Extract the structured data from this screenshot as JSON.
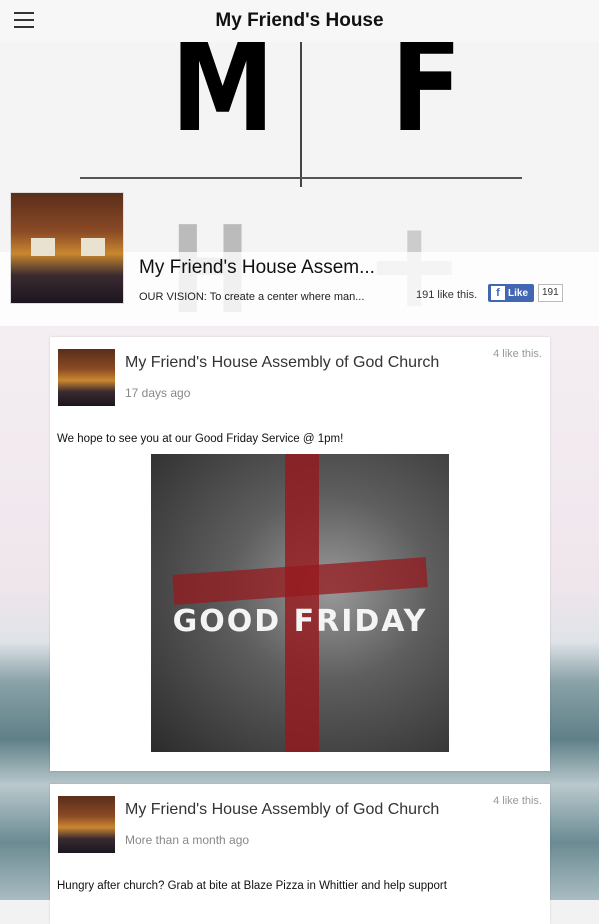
{
  "header": {
    "title": "My Friend's House",
    "menu_icon": "hamburger-menu-icon"
  },
  "cover": {
    "letters": [
      "M",
      "F",
      "H",
      "+"
    ]
  },
  "page": {
    "name": "My Friend's House Assem...",
    "vision": "OUR VISION: To create a center where man...",
    "likes_text": "191 like this.",
    "like_button": "Like",
    "like_count": "191"
  },
  "posts": [
    {
      "author": "My Friend's House Assembly of God Church",
      "time": "17 days ago",
      "likes": "4 like this.",
      "message": "We hope to see you at our Good Friday Service @ 1pm!",
      "image_text": "GOOD FRIDAY"
    },
    {
      "author": "My Friend's House Assembly of God Church",
      "time": "More than a month ago",
      "likes": "4 like this.",
      "message": "Hungry after church? Grab at bite at Blaze Pizza in Whittier and help support"
    }
  ]
}
